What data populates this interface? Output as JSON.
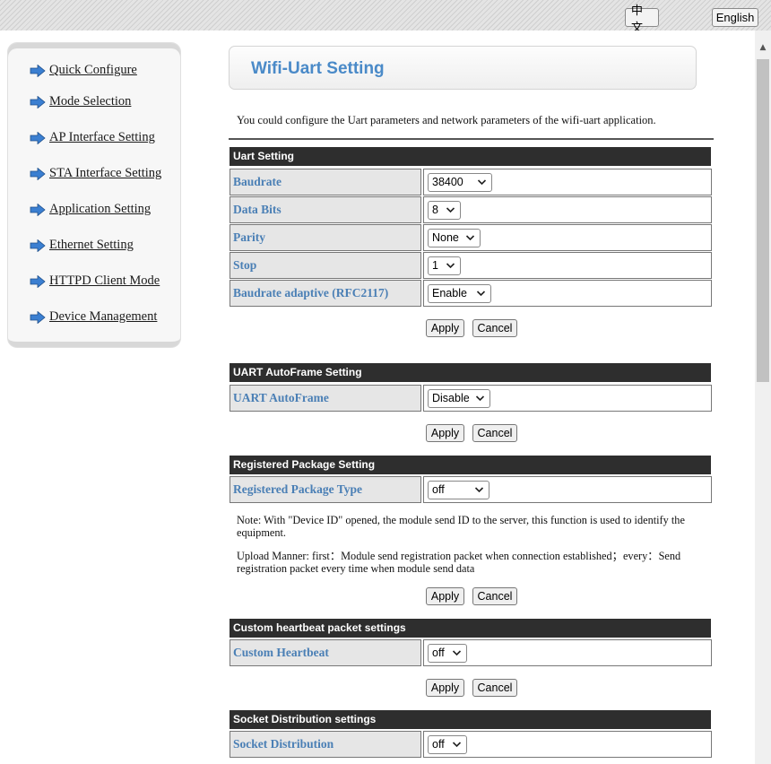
{
  "lang": {
    "zh": "中文",
    "en": "English"
  },
  "sidebar": {
    "items": [
      {
        "label": "Quick Configure"
      },
      {
        "label": "Mode Selection"
      },
      {
        "label": "AP Interface Setting"
      },
      {
        "label": "STA Interface Setting"
      },
      {
        "label": "Application Setting"
      },
      {
        "label": "Ethernet Setting"
      },
      {
        "label": "HTTPD Client Mode"
      },
      {
        "label": "Device Management"
      }
    ]
  },
  "page": {
    "title": "Wifi-Uart Setting",
    "intro": "You could configure the Uart parameters and network parameters of the wifi-uart application."
  },
  "uart": {
    "header": "Uart Setting",
    "baudrate_label": "Baudrate",
    "baudrate_value": "38400",
    "databits_label": "Data Bits",
    "databits_value": "8",
    "parity_label": "Parity",
    "parity_value": "None",
    "stop_label": "Stop",
    "stop_value": "1",
    "adaptive_label": "Baudrate adaptive (RFC2117)",
    "adaptive_value": "Enable"
  },
  "autoframe": {
    "header": "UART AutoFrame Setting",
    "label": "UART AutoFrame",
    "value": "Disable"
  },
  "registered": {
    "header": "Registered Package Setting",
    "label": "Registered Package Type",
    "value": "off",
    "note1": "Note: With \"Device ID\" opened, the module send ID to the server, this function is used to identify the equipment.",
    "note2": "Upload Manner: first：Module send registration packet when connection established；every：Send registration packet every time when module send data"
  },
  "heartbeat": {
    "header": "Custom heartbeat packet settings",
    "label": "Custom Heartbeat",
    "value": "off"
  },
  "socket": {
    "header": "Socket Distribution settings",
    "label": "Socket Distribution",
    "value": "off"
  },
  "buttons": {
    "apply": "Apply",
    "cancel": "Cancel"
  },
  "colors": {
    "title": "#4a8ac8",
    "label": "#4a7fb5",
    "header_bg": "#2e2e2e",
    "arrow": "#3b7fd1"
  }
}
